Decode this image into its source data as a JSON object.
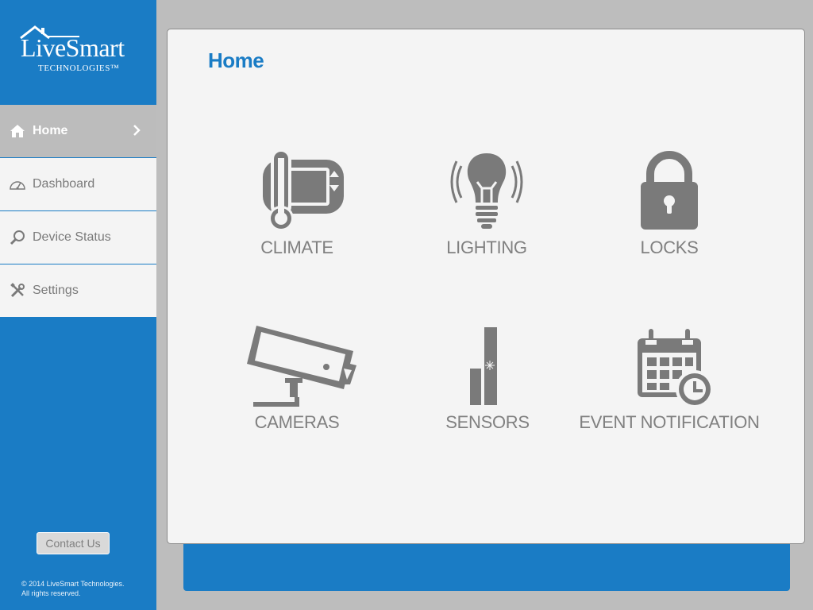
{
  "logo": {
    "brand": "LiveSmart",
    "sub": "TECHNOLOGIES™"
  },
  "nav": {
    "items": [
      {
        "label": "Home",
        "icon": "home-icon",
        "active": true
      },
      {
        "label": "Dashboard",
        "icon": "speedometer-icon"
      },
      {
        "label": "Device Status",
        "icon": "search-icon"
      },
      {
        "label": "Settings",
        "icon": "tools-icon"
      }
    ]
  },
  "contact_label": "Contact Us",
  "footer": {
    "line1": "© 2014 LiveSmart Technologies.",
    "line2": "All rights reserved."
  },
  "page_title": "Home",
  "tiles": [
    {
      "label": "CLIMATE",
      "icon": "thermostat-icon"
    },
    {
      "label": "LIGHTING",
      "icon": "lightbulb-icon"
    },
    {
      "label": "LOCKS",
      "icon": "padlock-icon"
    },
    {
      "label": "CAMERAS",
      "icon": "camera-icon"
    },
    {
      "label": "SENSORS",
      "icon": "sensor-icon"
    },
    {
      "label": "EVENT NOTIFICATION",
      "icon": "calendar-clock-icon"
    }
  ],
  "colors": {
    "accent": "#1a7cc5",
    "icon_gray": "#7a7a7a",
    "panel": "#f4f4f4"
  }
}
